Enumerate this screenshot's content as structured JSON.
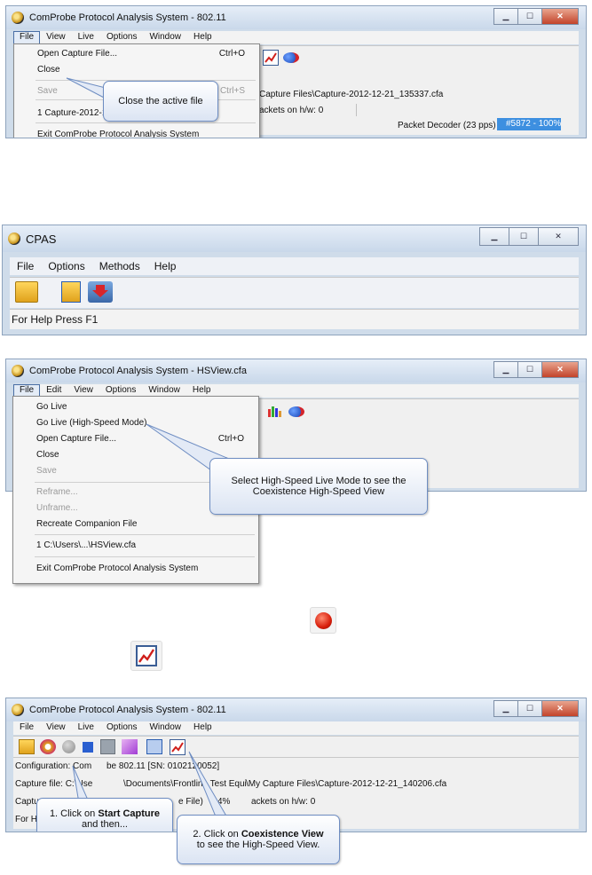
{
  "shot1": {
    "title": "ComProbe Protocol Analysis System - 802.11",
    "menu": [
      "File",
      "View",
      "Live",
      "Options",
      "Window",
      "Help"
    ],
    "dropdown": [
      {
        "label": "Open Capture File...",
        "shortcut": "Ctrl+O",
        "disabled": false
      },
      {
        "label": "Close",
        "shortcut": "",
        "disabled": false
      },
      {
        "label": "Save",
        "shortcut": "Ctrl+S",
        "disabled": true
      },
      {
        "label": "1 Capture-2012-1",
        "shortcut": "",
        "disabled": false
      },
      {
        "label": "Exit ComProbe Protocol Analysis System",
        "shortcut": "",
        "disabled": false
      }
    ],
    "capture_path": "Capture Files\\Capture-2012-12-21_135337.cfa",
    "packets": "ackets on h/w: 0",
    "decoder": "Packet Decoder (23 pps)",
    "progress": "#5872  -  100%",
    "callout": "Close the active file"
  },
  "shot2": {
    "title": "CPAS",
    "menu": [
      "File",
      "Options",
      "Methods",
      "Help"
    ],
    "status": "For Help Press F1"
  },
  "shot3": {
    "title": "ComProbe Protocol Analysis System - HSView.cfa",
    "menu": [
      "File",
      "Edit",
      "View",
      "Options",
      "Window",
      "Help"
    ],
    "dropdown": [
      {
        "label": "Go Live",
        "shortcut": "",
        "disabled": false
      },
      {
        "label": "Go Live (High-Speed Mode)",
        "shortcut": "",
        "disabled": false
      },
      {
        "label": "Open Capture File...",
        "shortcut": "Ctrl+O",
        "disabled": false
      },
      {
        "label": "Close",
        "shortcut": "",
        "disabled": false
      },
      {
        "label": "Save",
        "shortcut": "",
        "disabled": true
      },
      {
        "label": "Reframe...",
        "shortcut": "",
        "disabled": true
      },
      {
        "label": "Unframe...",
        "shortcut": "",
        "disabled": true
      },
      {
        "label": "Recreate Companion File",
        "shortcut": "",
        "disabled": false
      },
      {
        "label": "1 C:\\Users\\...\\HSView.cfa",
        "shortcut": "",
        "disabled": false
      },
      {
        "label": "Exit ComProbe Protocol Analysis System",
        "shortcut": "",
        "disabled": false
      }
    ],
    "callout": "Select High-Speed Live Mode to see the Coexistence  High-Speed View"
  },
  "shot4": {
    "title": "ComProbe Protocol Analysis System - 802.11",
    "menu": [
      "File",
      "View",
      "Live",
      "Options",
      "Window",
      "Help"
    ],
    "config": "Configuration: Com",
    "config_tail": "be 802.11 [SN: 0102120052]",
    "capture_file_a": "Capture file: C:\\Use",
    "capture_file_b": "\\Documents\\Frontline Test Equi",
    "capture_file_c": "\\My Capture Files\\Capture-2012-12-21_140206.cfa",
    "capture_row3_a": "Captur",
    "capture_row3_b": "e File)",
    "pct": "4%",
    "packets": "ackets on h/w: 0",
    "help_a": "For He",
    "callout1_prefix": "1. Click on ",
    "callout1_bold": "Start Capture",
    "callout1_suffix": "and then...",
    "callout2_prefix": "2. Click on ",
    "callout2_bold": "Coexistence View",
    "callout2_suffix": "to see the High-Speed View."
  }
}
